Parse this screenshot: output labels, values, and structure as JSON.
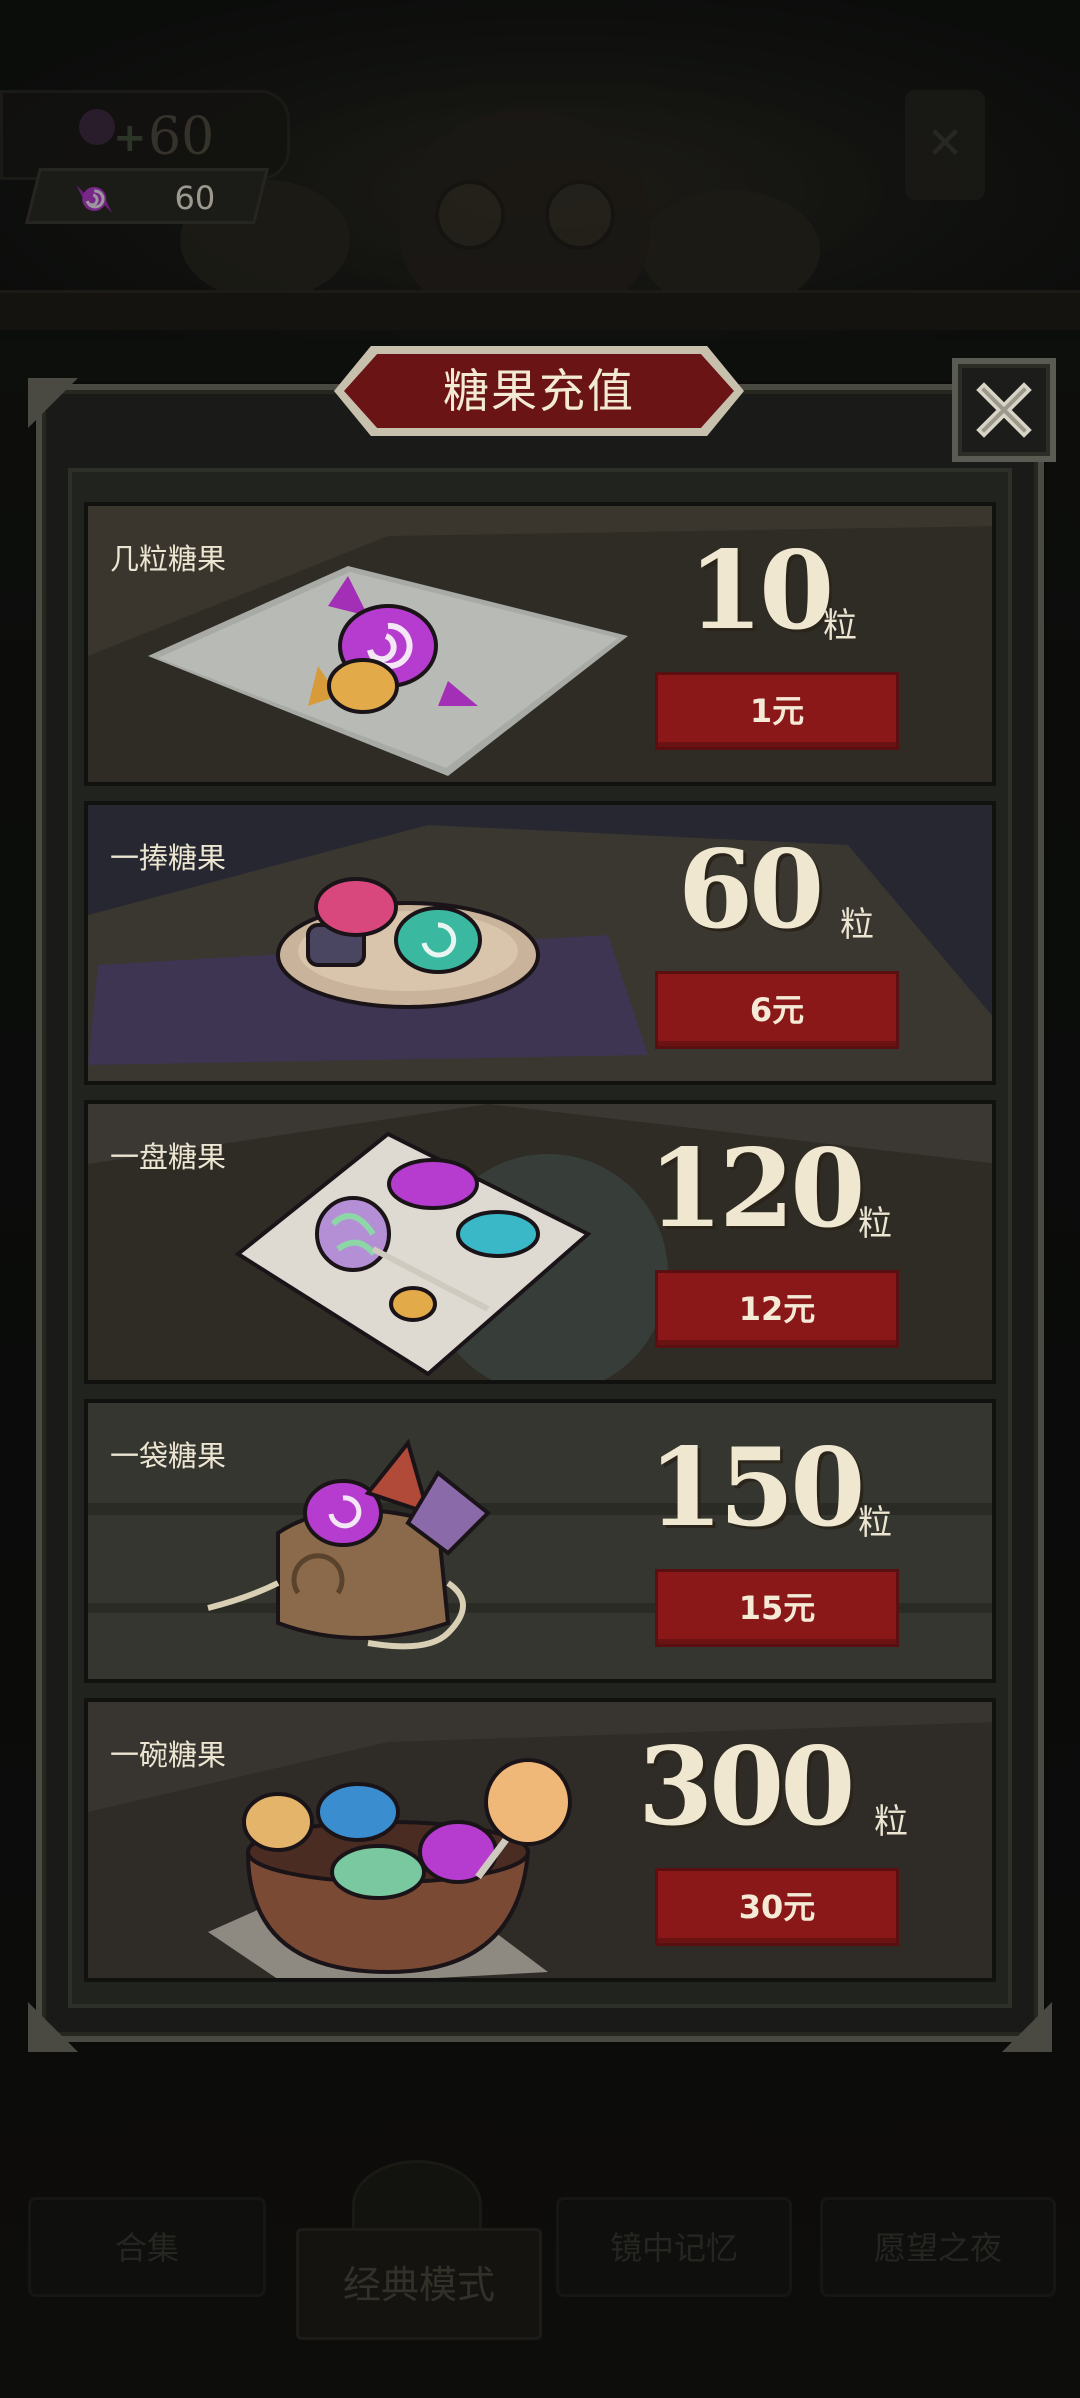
{
  "hud": {
    "pending_candies": "+60",
    "candy_balance": "60"
  },
  "dialog": {
    "title": "糖果充值"
  },
  "packs": [
    {
      "name": "几粒糖果",
      "amount": "10",
      "unit": "粒",
      "price": "1元"
    },
    {
      "name": "一捧糖果",
      "amount": "60",
      "unit": "粒",
      "price": "6元"
    },
    {
      "name": "一盘糖果",
      "amount": "120",
      "unit": "粒",
      "price": "12元"
    },
    {
      "name": "一袋糖果",
      "amount": "150",
      "unit": "粒",
      "price": "15元"
    },
    {
      "name": "一碗糖果",
      "amount": "300",
      "unit": "粒",
      "price": "30元"
    }
  ],
  "bottom_tabs": {
    "collection": "合集",
    "classic_mode": "经典模式",
    "mirror_memory": "镜中记忆",
    "wish_night": "愿望之夜"
  },
  "colors": {
    "price_button": "#8a1819",
    "title_plate": "#6a1416",
    "text_cream": "#efe7cf"
  }
}
